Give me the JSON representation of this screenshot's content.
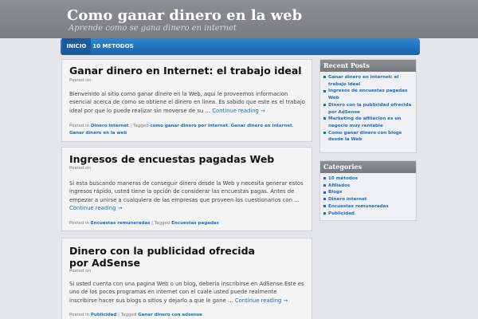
{
  "site": {
    "title": "Como ganar dinero en la web",
    "tagline": "Aprende como se gana dinero en internet"
  },
  "nav": {
    "items": [
      {
        "label": "INICIO",
        "active": true
      },
      {
        "label": "10 METODOS",
        "active": false
      }
    ]
  },
  "posts": [
    {
      "title": "Ganar dinero en Internet: el trabajo ideal",
      "posted_on": "Posted on",
      "body": "Bienvenido al sitio como ganar dinero en la Web, aqui le proveemos informacion esencial acerca de como se obtiene el dinero en linea. Es sabido que este es el trabajo ideal por que lo puede realizar sin moverse de su …",
      "more": "Continue reading →",
      "posted_in_label": "Posted in",
      "category": "Dinero internet",
      "tagged_label": "Tagged",
      "tags": [
        "como ganar dinero por internet",
        "Ganar dinero en internet",
        "Ganar dinero en la web"
      ]
    },
    {
      "title": "Ingresos de encuestas pagadas Web",
      "posted_on": "Posted on",
      "body": "Si esta buscando maneras de conseguir dinero desde la Web y necesita generar estos ingresos rápido, usted tiene la opción de considerar las encuestas pagas. Antes de empezar a unirse a cualquiera de las empresas que proveen los cuestionarios con …",
      "more": "Continue reading →",
      "posted_in_label": "Posted in",
      "category": "Encuestas remuneradas",
      "tagged_label": "Tagged",
      "tags": [
        "Encuestas pagadas"
      ]
    },
    {
      "title": "Dinero con la publicidad ofrecida por AdSense",
      "posted_on": "Posted on",
      "body": "Si usted cuenta con una pagina Web o un blog, debería inscribirse en AdSense.Este es uno de los pocos programas en internet con el cuale usted puede realmente inscribirse hacer sus blogs o sitios y dejarlo a que le gane …",
      "more": "Continue reading →",
      "posted_in_label": "Posted in",
      "category": "Publicidad",
      "tagged_label": "Tagged",
      "tags": [
        "Ganar dinero con adsense"
      ]
    }
  ],
  "sidebar": {
    "recent": {
      "title": "Recent Posts",
      "items": [
        "Ganar dinero en Internet: el trabajo ideal",
        "Ingresos de encuestas pagadas Web",
        "Dinero con la publicidad ofrecida por AdSense",
        "Marketing de afiliacion es un negocio muy rentable",
        "Como ganar dinero con blogs desde la Web"
      ]
    },
    "categories": {
      "title": "Categories",
      "items": [
        "10 métodos",
        "Afiliados",
        "Blogs",
        "Dinero internet",
        "Encuestas remuneradas",
        "Publicidad"
      ]
    }
  }
}
